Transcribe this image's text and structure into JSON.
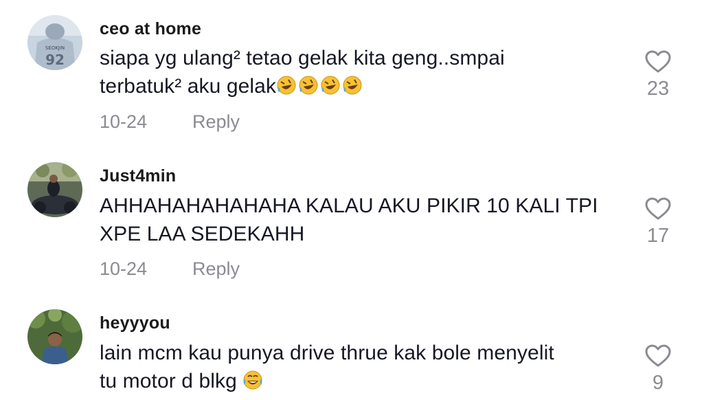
{
  "comments": [
    {
      "username": "ceo at home",
      "line1": "siapa yg ulang² tetao gelak kita geng..smpai",
      "line2": "terbatuk² aku gelak",
      "date": "10-24",
      "reply_label": "Reply",
      "likes": "23",
      "avatar_text": "SEOKJIN 92",
      "emoji_after_text": [
        "rolling-laughing-emoji",
        "rolling-laughing-emoji",
        "rolling-laughing-emoji",
        "rolling-laughing-emoji"
      ]
    },
    {
      "username": "Just4min",
      "line1": "AHHAHAHAHAHAHA KALAU AKU PIKIR 10 KALI TPI",
      "line2": "XPE LAA SEDEKAHH",
      "date": "10-24",
      "reply_label": "Reply",
      "likes": "17"
    },
    {
      "username": "heyyyou",
      "line1": "lain mcm kau punya drive thrue kak bole menyelit",
      "line2": "tu motor d blkg",
      "likes": "9",
      "emoji_after_text": [
        "tears-of-joy-emoji"
      ]
    }
  ],
  "colors": {
    "text": "#161823",
    "secondary": "#8a8b91",
    "heart_outline": "#8a8b91"
  }
}
